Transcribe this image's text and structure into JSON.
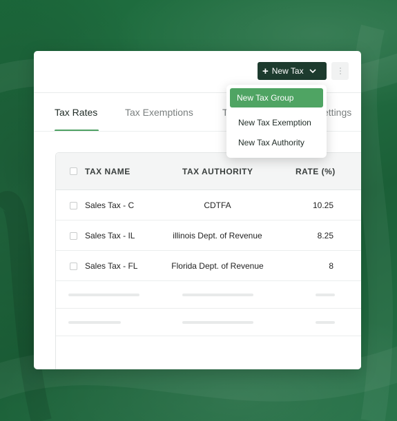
{
  "toolbar": {
    "new_tax_label": "New Tax"
  },
  "dropdown": {
    "items": [
      {
        "label": "New Tax Group",
        "highlighted": true
      },
      {
        "label": "New Tax Exemption",
        "highlighted": false
      },
      {
        "label": "New Tax Authority",
        "highlighted": false
      }
    ]
  },
  "tabs": [
    {
      "label": "Tax Rates",
      "active": true
    },
    {
      "label": "Tax Exemptions",
      "active": false
    },
    {
      "label": "T",
      "active": false
    },
    {
      "label": "ettings",
      "active": false
    }
  ],
  "table": {
    "columns": [
      "TAX NAME",
      "TAX AUTHORITY",
      "RATE (%)"
    ],
    "rows": [
      {
        "name": "Sales Tax - C",
        "authority": "CDTFA",
        "rate": "10.25"
      },
      {
        "name": "Sales Tax - IL",
        "authority": "illinois Dept. of Revenue",
        "rate": "8.25"
      },
      {
        "name": "Sales Tax - FL",
        "authority": "Florida Dept. of Revenue",
        "rate": "8"
      }
    ]
  },
  "colors": {
    "background_green": "#1f6a3f",
    "primary_button": "#1d3b2e",
    "accent_green": "#4fa463"
  },
  "icons": {
    "new_tax_button": [
      "plus-icon",
      "chevron-down-icon"
    ],
    "more_button": "more-vertical-icon"
  }
}
